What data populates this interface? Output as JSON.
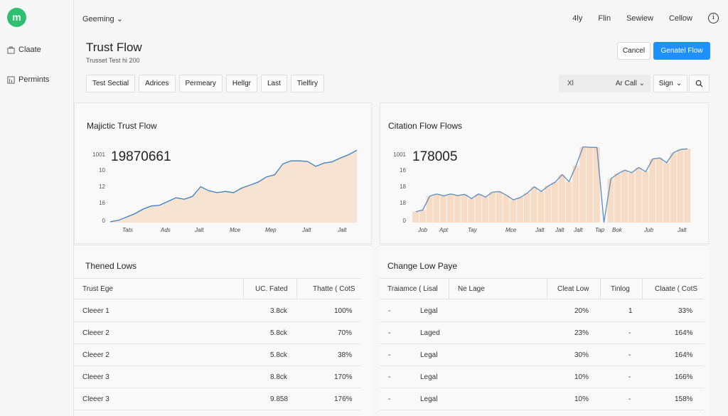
{
  "sidebar": {
    "logo_text": "m",
    "items": [
      {
        "label": "Claate",
        "icon": "briefcase-icon"
      },
      {
        "label": "Permints",
        "icon": "chart-icon"
      }
    ]
  },
  "topbar": {
    "workspace": "Geeming",
    "nav": [
      "4ly",
      "Flin",
      "Sewiew",
      "Cellow"
    ],
    "info_icon": "info-icon"
  },
  "header": {
    "title": "Trust Flow",
    "subtitle": "Trusset Test hi 200",
    "cancel_label": "Cancel",
    "primary_label": "Genatel Flow"
  },
  "tabs": [
    "Test Sectial",
    "Adrices",
    "Permeary",
    "Hellgr",
    "Last",
    "Tielfiry"
  ],
  "filter": {
    "prefix": "Xl",
    "value": "Ar Call"
  },
  "sign_label": "Sign",
  "charts": {
    "left": {
      "title": "Majictic Trust Flow",
      "big_number": "19870661",
      "yticks": [
        "1001",
        "10",
        "12",
        "16",
        "0"
      ],
      "xticks": [
        "Tats",
        "Ads",
        "Jalt",
        "Mce",
        "Mep",
        "Jalt",
        "Jalt"
      ]
    },
    "right": {
      "title": "Citation Flow Flows",
      "big_number": "178005",
      "yticks": [
        "1001",
        "16",
        "18",
        "18",
        "0"
      ],
      "xticks": [
        "Job",
        "Apt",
        "Tay",
        "Mce",
        "Jalt",
        "Jalt",
        "Jalt",
        "Tap",
        "Bok",
        "Jub",
        "Jalt"
      ]
    }
  },
  "chart_data": [
    {
      "type": "area",
      "title": "Majictic Trust Flow",
      "values": [
        0.5,
        1.5,
        3.6,
        5.8,
        8.8,
        10.8,
        11.3,
        13.7,
        16.2,
        15.2,
        17,
        23.4,
        20.7,
        19.5,
        20.3,
        19.5,
        22.5,
        24.4,
        26.4,
        29.7,
        31.1,
        38.2,
        40.2,
        40.2,
        39.8,
        36.6,
        38.7,
        39.6,
        42.1,
        44.2,
        47.1
      ],
      "color": "#3a7fc0",
      "fill": "#f6e3d2"
    },
    {
      "type": "bar",
      "title": "Citation Flow Flows",
      "values": [
        7.1,
        8.2,
        17.2,
        18.6,
        17.4,
        18.6,
        17.6,
        18.4,
        15.6,
        18.6,
        16.6,
        19.8,
        20.2,
        17.8,
        14.8,
        16.3,
        19.2,
        23.3,
        20.3,
        23.8,
        26.3,
        31.2,
        26.6,
        37.1,
        49.3,
        49,
        48.9,
        0,
        28.5,
        31.8,
        34.1,
        32.5,
        35.9,
        33.1,
        41.4,
        42.1,
        39,
        45.6,
        47.6,
        48
      ],
      "color": "#5a8cc5",
      "fill": "#f6dcc5"
    }
  ],
  "tables": {
    "left": {
      "title": "Thened Lows",
      "columns": [
        "Trust Ege",
        "UC. Fated",
        "Thatte ( CotS"
      ],
      "rows": [
        [
          "Cleeer 1",
          "3.8ck",
          "100%"
        ],
        [
          "Cleeer 2",
          "5.8ck",
          "70%"
        ],
        [
          "Cleeer 2",
          "5.8ck",
          "38%"
        ],
        [
          "Cleeer 3",
          "8.8ck",
          "170%"
        ],
        [
          "Cleeer 3",
          "9.858",
          "176%"
        ]
      ]
    },
    "right": {
      "title": "Change Low Paye",
      "columns": [
        "Traiamce ( Lisal",
        "Ne Lage",
        "Cleat Low",
        "Tinlog",
        "Claate ( CotS"
      ],
      "rows": [
        [
          "-",
          "Legal",
          "20%",
          "1",
          "33%"
        ],
        [
          "-",
          "Laged",
          "23%",
          "-",
          "164%"
        ],
        [
          "-",
          "Legal",
          "30%",
          "-",
          "164%"
        ],
        [
          "-",
          "Legal",
          "10%",
          "-",
          "166%"
        ],
        [
          "-",
          "Legal",
          "10%",
          "-",
          "158%"
        ]
      ]
    }
  }
}
